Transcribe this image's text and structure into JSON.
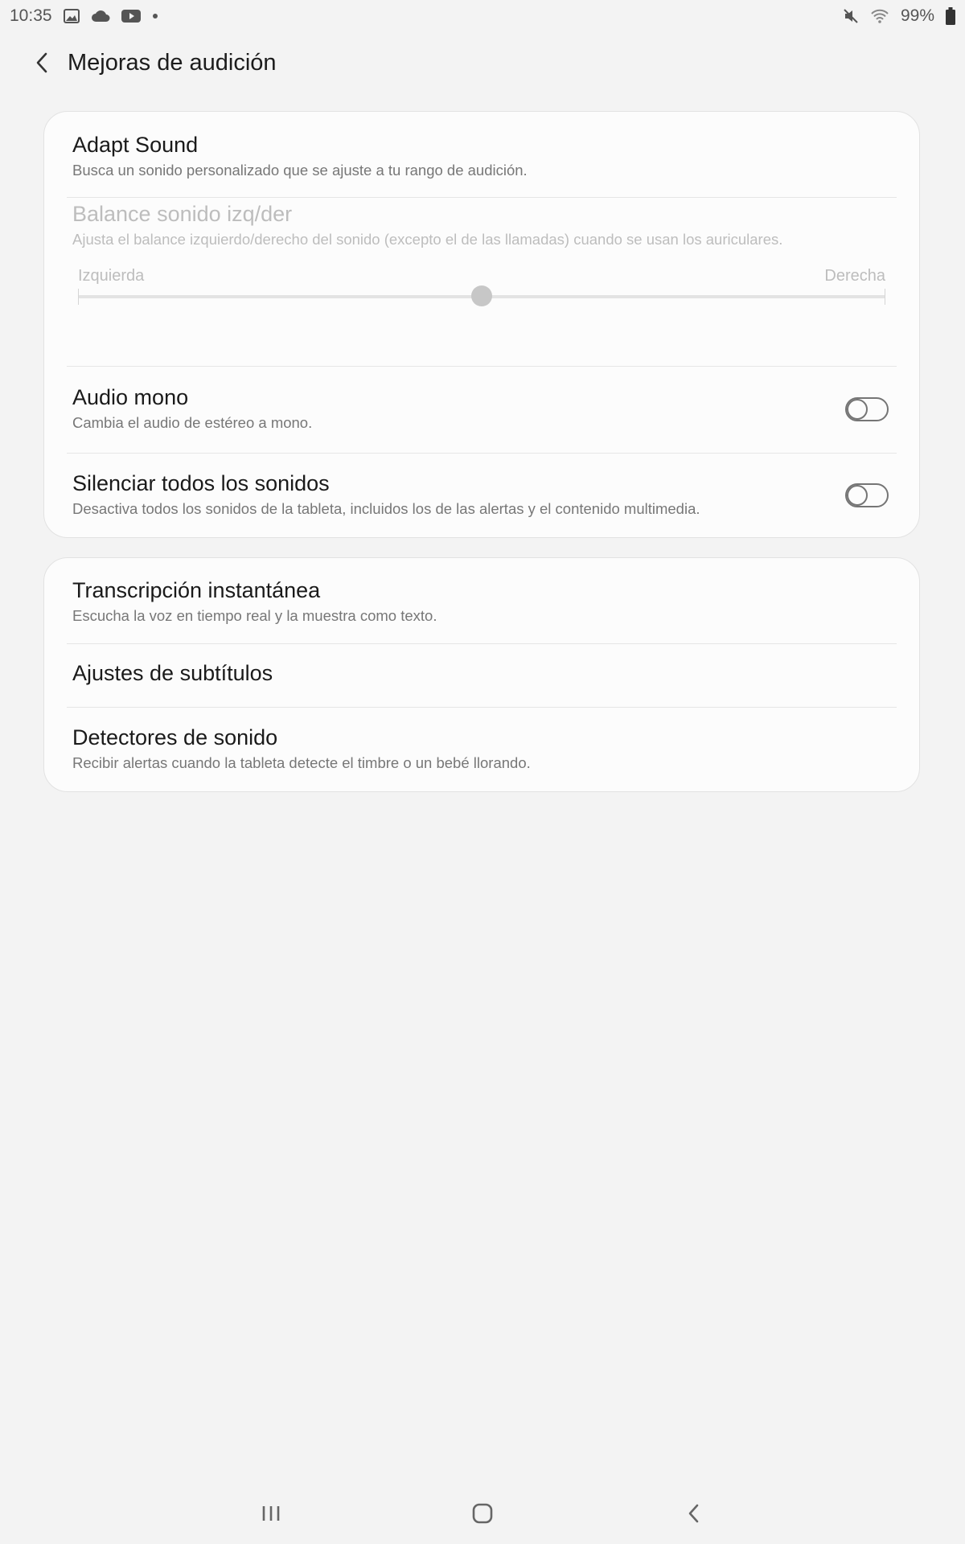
{
  "status_bar": {
    "time": "10:35",
    "left_icons": [
      "gallery-icon",
      "cloud-icon",
      "youtube-icon",
      "dot-icon"
    ],
    "right_icons": [
      "mute-icon",
      "wifi-icon",
      "battery-icon"
    ],
    "battery": "99%"
  },
  "header": {
    "back_icon": "chevron-left-icon",
    "title": "Mejoras de audición"
  },
  "card1": {
    "adapt_sound": {
      "title": "Adapt Sound",
      "subtitle": "Busca un sonido personalizado que se ajuste a tu rango de audición."
    },
    "balance": {
      "title": "Balance sonido izq/der",
      "subtitle": "Ajusta el balance izquierdo/derecho del sonido (excepto el de las llamadas) cuando se usan los auriculares.",
      "left_label": "Izquierda",
      "right_label": "Derecha",
      "value_fraction": 0.5,
      "enabled": false
    },
    "audio_mono": {
      "title": "Audio mono",
      "subtitle": "Cambia el audio de estéreo a mono.",
      "toggle_on": false
    },
    "mute_all": {
      "title": "Silenciar todos los sonidos",
      "subtitle": "Desactiva todos los sonidos de la tableta, incluidos los de las alertas y el contenido multimedia.",
      "toggle_on": false
    }
  },
  "card2": {
    "live_transcribe": {
      "title": "Transcripción instantánea",
      "subtitle": "Escucha la voz en tiempo real y la muestra como texto."
    },
    "subtitles": {
      "title": "Ajustes de subtítulos"
    },
    "sound_detectors": {
      "title": "Detectores de sonido",
      "subtitle": "Recibir alertas cuando la tableta detecte el timbre o un bebé llorando."
    }
  },
  "nav_bar": {
    "icons": [
      "recents-icon",
      "home-icon",
      "back-icon"
    ]
  },
  "colors": {
    "background": "#f3f3f3",
    "card": "#fcfcfc",
    "disabled_text": "#bdbdbd",
    "toggle_outline": "#757575"
  }
}
